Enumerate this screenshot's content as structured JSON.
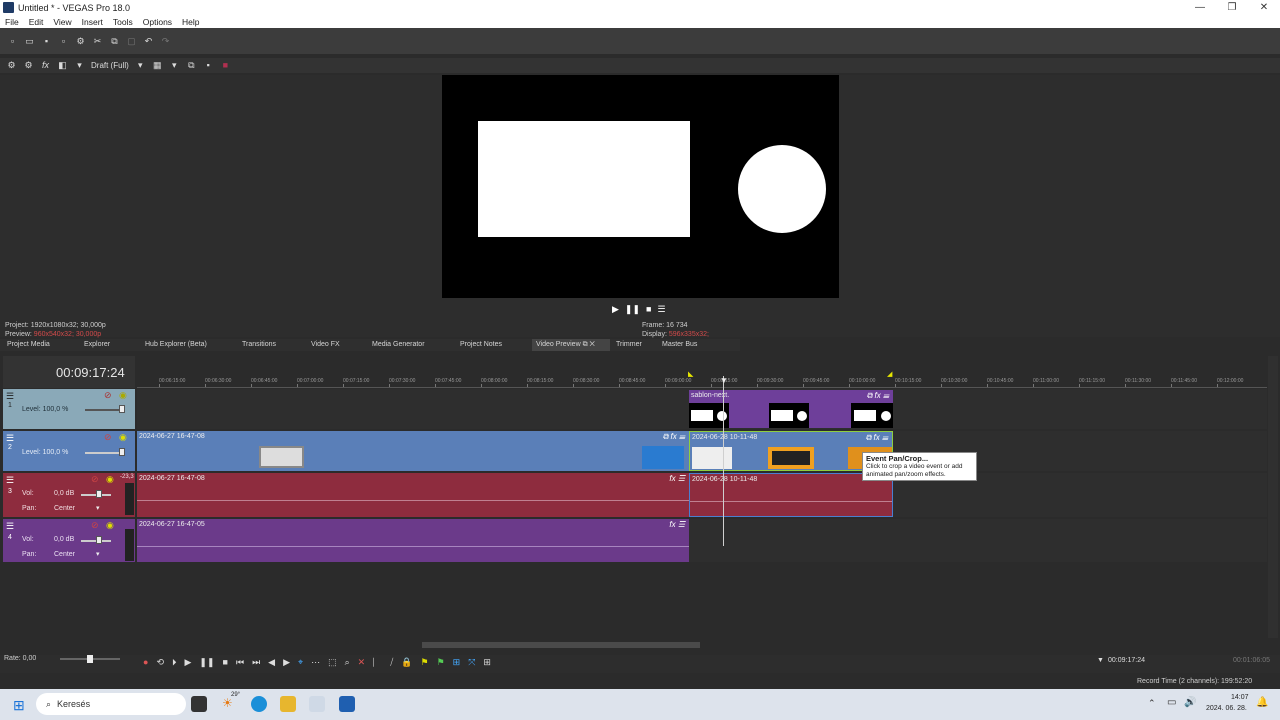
{
  "window": {
    "title": "Untitled * - VEGAS Pro 18.0",
    "controls": [
      "—",
      "❐",
      "✕"
    ]
  },
  "menu": [
    "File",
    "Edit",
    "View",
    "Insert",
    "Tools",
    "Options",
    "Help"
  ],
  "preview": {
    "quality": "Draft (Full)",
    "project_label": "Project:",
    "project_value": "1920x1080x32; 30,000p",
    "preview_label": "Preview:",
    "preview_value": "960x540x32; 30,000p",
    "frame_label": "Frame:",
    "frame_value": "16 734",
    "display_label": "Display:",
    "display_value": "596x335x32;"
  },
  "tabs": [
    {
      "label": "Project Media"
    },
    {
      "label": "Explorer"
    },
    {
      "label": "Hub Explorer (Beta)"
    },
    {
      "label": "Transitions"
    },
    {
      "label": "Video FX"
    },
    {
      "label": "Media Generator"
    },
    {
      "label": "Project Notes"
    },
    {
      "label": "Video Preview"
    },
    {
      "label": "Trimmer"
    },
    {
      "label": "Master Bus"
    }
  ],
  "timeline": {
    "timecode": "00:09:17:24",
    "ruler": [
      "00:06:15:00",
      "00:06:30:00",
      "00:06:45:00",
      "00:07:00:00",
      "00:07:15:00",
      "00:07:30:00",
      "00:07:45:00",
      "00:08:00:00",
      "00:08:15:00",
      "00:08:30:00",
      "00:08:45:00",
      "00:09:00:00",
      "00:09:15:00",
      "00:09:30:00",
      "00:09:45:00",
      "00:10:00:00",
      "00:10:15:00",
      "00:10:30:00",
      "00:10:45:00",
      "00:11:00:00",
      "00:11:15:00",
      "00:11:30:00",
      "00:11:45:00",
      "00:12:00:00"
    ],
    "tracks": [
      {
        "num": "1",
        "level": "Level: 100,0 %"
      },
      {
        "num": "2",
        "level": "Level: 100,0 %"
      },
      {
        "num": "3",
        "vol_label": "Vol:",
        "vol": "0,0 dB",
        "pan_label": "Pan:",
        "pan": "Center",
        "peak": "-23,3"
      },
      {
        "num": "4",
        "vol_label": "Vol:",
        "vol": "0,0 dB",
        "pan_label": "Pan:",
        "pan": "Center"
      }
    ],
    "clips": {
      "t1_clip": "sablon-next.",
      "t2_clip_a": "2024-06-27 16-47-08",
      "t2_clip_b": "2024-06-28 10-11-48",
      "t3_clip_a": "2024-06-27 16-47-08",
      "t3_clip_b": "2024-06-28 10-11-48",
      "t4_clip_a": "2024-06-27 16-47-05"
    },
    "tooltip_title": "Event Pan/Crop...",
    "tooltip_body": "Click to crop a video event or add animated pan/zoom effects."
  },
  "bottom": {
    "rate": "Rate: 0,00",
    "cursor_time": "00:09:17:24",
    "end_time": "00:01:06:05",
    "record_time": "Record Time (2 channels): 199:52:20"
  },
  "taskbar": {
    "search_placeholder": "Keresés",
    "weather": "29°",
    "time": "14:07",
    "date": "2024. 06. 28."
  },
  "colors": {
    "video_track": "#5a7fb8",
    "audio_track_red": "#8e2c3e",
    "audio_track_purple": "#6b3a8a",
    "track1_clip": "#6e3f9a"
  }
}
